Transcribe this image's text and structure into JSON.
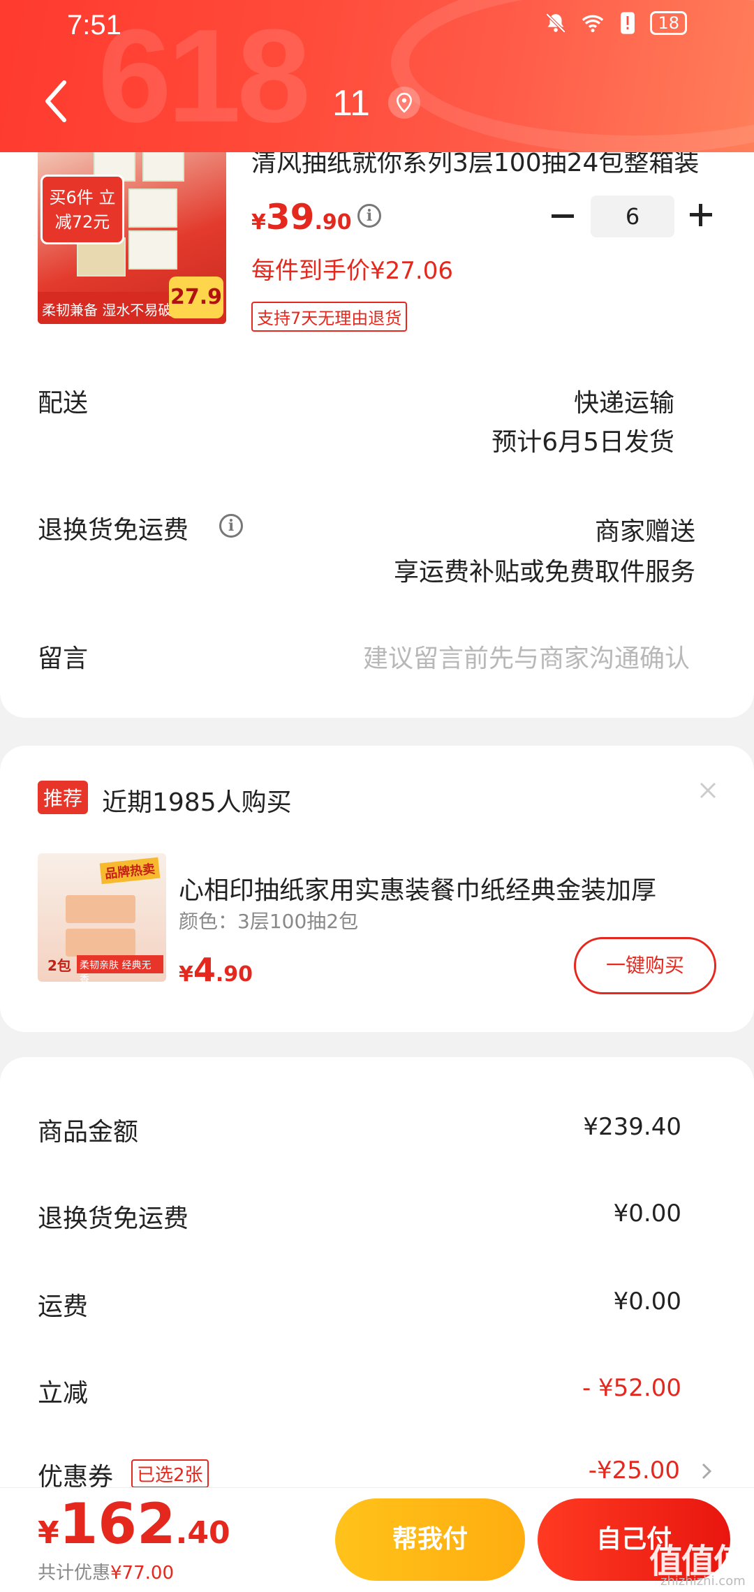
{
  "status_bar": {
    "time": "7:51",
    "battery": "18"
  },
  "header": {
    "title": "11"
  },
  "product": {
    "title": "清风抽纸就你系列3层100抽24包整箱装",
    "price_currency": "¥",
    "price_int": "39",
    "price_dec": ".90",
    "quantity": "6",
    "per_item_price": "每件到手价¥27.06",
    "return_badge": "支持7天无理由退货",
    "image_tag": "买6件 立减72元",
    "image_bottom": "柔韧兼备 湿水不易破",
    "image_price": "27.9"
  },
  "delivery": {
    "label": "配送",
    "method": "快递运输",
    "eta": "预计6月5日发货"
  },
  "return_shipping": {
    "label": "退换货免运费",
    "value1": "商家赠送",
    "value2": "享运费补贴或免费取件服务"
  },
  "message": {
    "label": "留言",
    "placeholder": "建议留言前先与商家沟通确认"
  },
  "recommend": {
    "badge": "推荐",
    "text": "近期1985人购买",
    "item_title": "心相印抽纸家用实惠装餐巾纸经典金装加厚",
    "item_spec": "颜色：3层100抽2包",
    "price_currency": "¥",
    "price_int": "4",
    "price_dec": ".90",
    "buy_button": "一键购买",
    "image_hot": "品牌热卖",
    "image_band": "柔韧亲肤 经典无香",
    "image_count": "2包"
  },
  "summary": {
    "rows": [
      {
        "label": "商品金额",
        "value": "¥239.40"
      },
      {
        "label": "退换货免运费",
        "value": "¥0.00"
      },
      {
        "label": "运费",
        "value": "¥0.00"
      },
      {
        "label": "立减",
        "value": "- ¥52.00"
      },
      {
        "label": "优惠券",
        "value": "-¥25.00"
      }
    ],
    "coupon_badge": "已选2张"
  },
  "footer": {
    "total_currency": "¥",
    "total_int": "162",
    "total_dec": ".40",
    "saved_label": "共计优惠",
    "saved_amount": "¥77.00",
    "help_pay": "帮我付",
    "self_pay": "自己付",
    "watermark": "值值值",
    "watermark_sub": "zhizhizhi.com"
  },
  "colors": {
    "accent": "#e5281e",
    "header": "#ff4b3a",
    "help_btn": "#ffbb18"
  }
}
